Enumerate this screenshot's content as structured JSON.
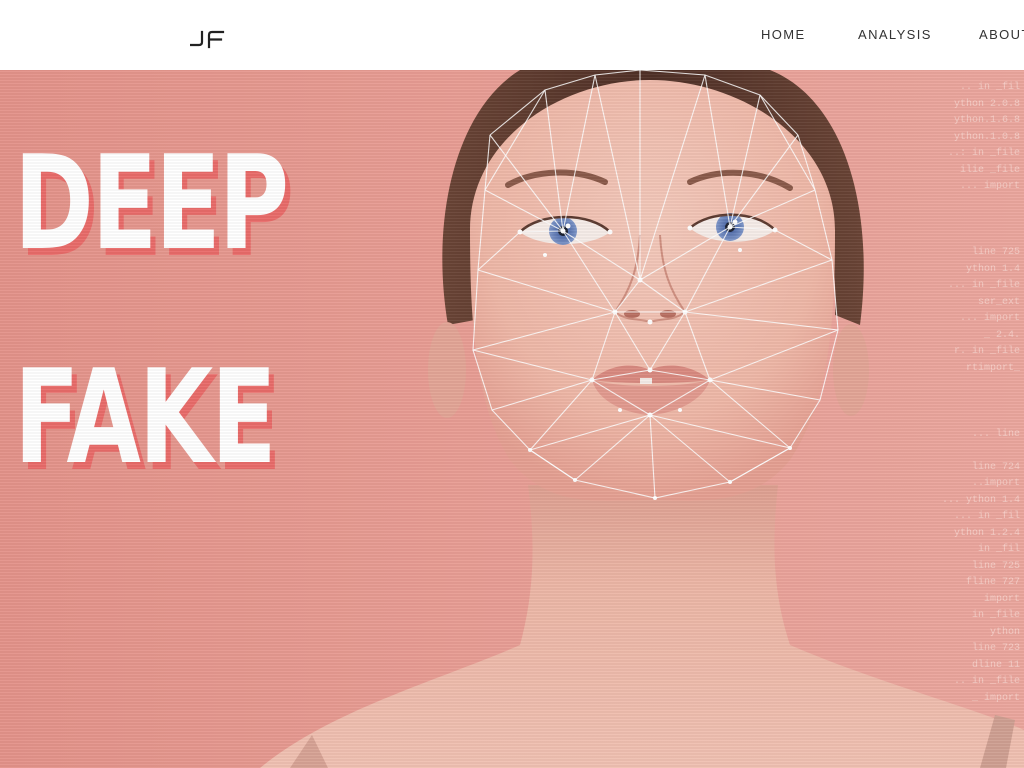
{
  "nav": {
    "logo_text": "JF",
    "items": [
      {
        "label": "HOME"
      },
      {
        "label": "ANALYSIS"
      },
      {
        "label": "ABOUT"
      }
    ]
  },
  "hero": {
    "headline_line1": "DEEP",
    "headline_line2": "FAKE",
    "image_subject": "woman-face-with-facial-landmark-mesh",
    "code_lines": [
      ".. in _fil",
      "ython 2.0.8",
      "ython.1.6.8",
      "ython.1.0.8",
      "..: in _file",
      "ilie _file",
      "... import",
      "",
      "",
      "",
      "line 725",
      "ython 1.4",
      "... in _file",
      "ser_ext",
      "... import",
      "_ 2.4.",
      "r. in _file",
      "rtimport_",
      "",
      "",
      "",
      "... line",
      "",
      "line 724",
      "..import",
      "... ython 1.4",
      "... in _fil",
      "ython 1.2.4",
      "in _fil",
      "line 725",
      "fline 727",
      "import",
      "in _file",
      "ython",
      "line 723",
      "dline 11",
      ".. in _file",
      "_ import"
    ]
  },
  "colors": {
    "hero_background": "#e89d94",
    "headline_text": "#ffffff",
    "headline_shadow": "#e96c6a",
    "mesh_lines": "#ffffff",
    "iris": "#6f86bf",
    "nav_text": "#333333"
  }
}
